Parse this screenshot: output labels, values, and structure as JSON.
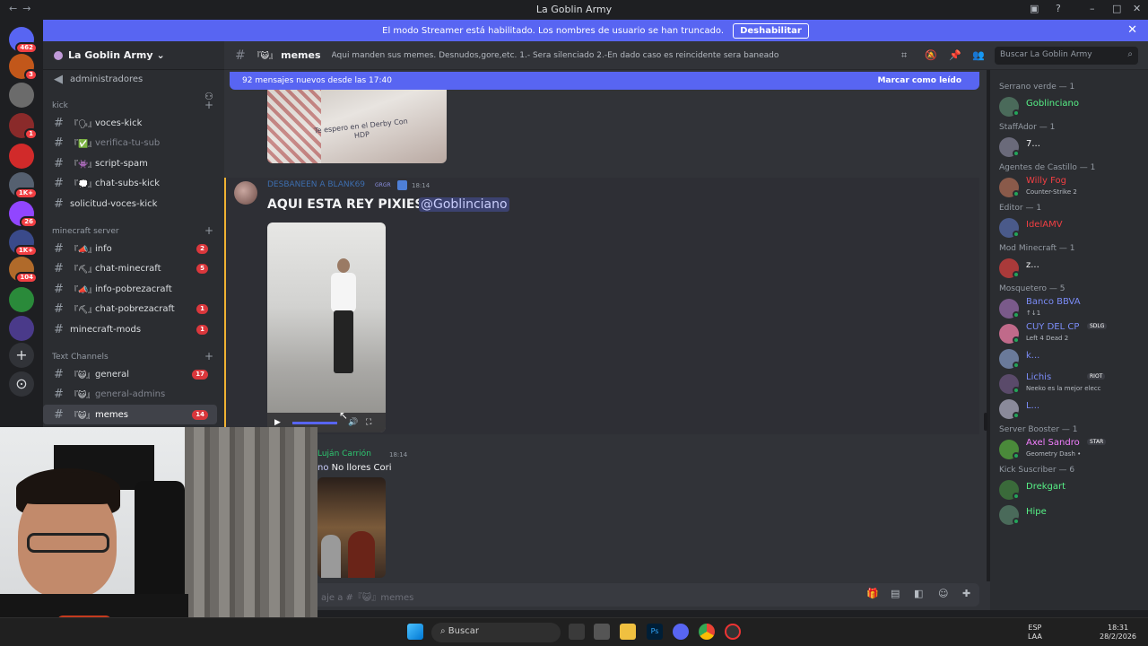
{
  "window": {
    "title": "La Goblin Army"
  },
  "banner": {
    "text": "El modo Streamer está habilitado. Los nombres de usuario se han truncado.",
    "button": "Deshabilitar"
  },
  "servers": [
    {
      "badge": "462",
      "color": "#5865f2"
    },
    {
      "badge": "3",
      "color": "#c2571a"
    },
    {
      "badge": "",
      "color": "#6b6b6b"
    },
    {
      "badge": "1",
      "color": "#8a2a2a"
    },
    {
      "badge": "",
      "color": "#d12a2a"
    },
    {
      "badge": "1K+",
      "color": "#556070"
    },
    {
      "badge": "26",
      "color": "#9146ff"
    },
    {
      "badge": "1K+",
      "color": "#3a4a8a"
    },
    {
      "badge": "104",
      "color": "#b06a2a"
    },
    {
      "badge": "",
      "color": "#2a8a3a"
    },
    {
      "badge": "",
      "color": "#4a3a8a"
    }
  ],
  "guild": {
    "name": "La Goblin Army"
  },
  "channels": {
    "admin": "administradores",
    "categories": [
      "kick",
      "minecraft server",
      "Text Channels"
    ],
    "kick": [
      {
        "emoji": "『🗣』",
        "name": "voces-kick",
        "count": "",
        "muted": false
      },
      {
        "emoji": "『✅』",
        "name": "verifica-tu-sub",
        "count": "",
        "muted": true
      },
      {
        "emoji": "『👾』",
        "name": "script-spam",
        "count": "",
        "muted": false
      },
      {
        "emoji": "『💭』",
        "name": "chat-subs-kick",
        "count": "",
        "muted": false
      },
      {
        "emoji": "",
        "name": "solicitud-voces-kick",
        "count": "",
        "muted": false
      }
    ],
    "minecraft": [
      {
        "emoji": "『📣』",
        "name": "info",
        "count": "2",
        "muted": false
      },
      {
        "emoji": "『⛏』",
        "name": "chat-minecraft",
        "count": "5",
        "muted": false
      },
      {
        "emoji": "『📣』",
        "name": "info-pobrezacraft",
        "count": "",
        "muted": false
      },
      {
        "emoji": "『⛏』",
        "name": "chat-pobrezacraft",
        "count": "1",
        "muted": false
      },
      {
        "emoji": "",
        "name": "minecraft-mods",
        "count": "1",
        "muted": false
      }
    ],
    "text": [
      {
        "emoji": "『😺』",
        "name": "general",
        "count": "17",
        "muted": false
      },
      {
        "emoji": "『😺』",
        "name": "general-admins",
        "count": "",
        "muted": true
      },
      {
        "emoji": "『😺』",
        "name": "memes",
        "count": "14",
        "muted": false,
        "selected": true
      }
    ]
  },
  "header": {
    "channel": "memes",
    "emoji": "『😺』",
    "topic": "Aqui manden sus memes. Desnudos,gore,etc. 1.- Sera silenciado 2.-En dado caso es reincidente sera baneado",
    "search_placeholder": "Buscar La Goblin Army"
  },
  "newbar": {
    "text": "92 mensajes nuevos desde las 17:40",
    "action": "Marcar como leído"
  },
  "image1": {
    "handwriting": "Te espero en el Derby Con HDP"
  },
  "message2": {
    "author": "DESBANEEN A BLANK69",
    "tag": "GRGR",
    "time": "18:14",
    "text": "AQUI ESTA REY PIXIES",
    "mention": "@Goblinciano"
  },
  "message3": {
    "author": "Luján Carrión",
    "time": "18:14",
    "text_prefix": "no",
    "text": "No llores Cori"
  },
  "input": {
    "placeholder": "aje a #『😺』memes"
  },
  "members": [
    {
      "role": "Serrano verde",
      "count": "1",
      "users": [
        {
          "name": "Goblinciano",
          "status": "",
          "color": "#57f287"
        }
      ]
    },
    {
      "role": "StaffAdor",
      "count": "1",
      "users": [
        {
          "name": "7...",
          "status": "",
          "color": "#f2f3f5"
        }
      ]
    },
    {
      "role": "Agentes de Castillo",
      "count": "1",
      "users": [
        {
          "name": "Willy Fog",
          "status": "Counter-Strike 2",
          "color": "#f23f43"
        }
      ]
    },
    {
      "role": "Editor",
      "count": "1",
      "users": [
        {
          "name": "IdelAMV",
          "status": "",
          "color": "#f23f43"
        }
      ]
    },
    {
      "role": "Mod Minecraft",
      "count": "1",
      "users": [
        {
          "name": "z...",
          "status": "",
          "color": "#f2f3f5"
        }
      ]
    },
    {
      "role": "Mosquetero",
      "count": "5",
      "users": [
        {
          "name": "Banco BBVA",
          "status": "↑↓1",
          "color": "#7b8cf7"
        },
        {
          "name": "CUY DEL CP",
          "status": "Left 4 Dead 2",
          "color": "#7b8cf7",
          "tag": "SDLG"
        },
        {
          "name": "k...",
          "status": "",
          "color": "#7b8cf7"
        },
        {
          "name": "Lichis",
          "status": "Neeko es la mejor elecc",
          "color": "#7b8cf7",
          "tag": "RIOT"
        },
        {
          "name": "L...",
          "status": "",
          "color": "#7b8cf7"
        }
      ]
    },
    {
      "role": "Server Booster",
      "count": "1",
      "users": [
        {
          "name": "Axel Sandro",
          "status": "Geometry Dash •",
          "color": "#f47fff",
          "tag": "STAR"
        }
      ]
    },
    {
      "role": "Kick Suscriber",
      "count": "6",
      "users": [
        {
          "name": "Drekgart",
          "status": "",
          "color": "#57f287"
        },
        {
          "name": "Hipe",
          "status": "",
          "color": "#57f287"
        }
      ]
    }
  ],
  "taskbar": {
    "search": "Buscar",
    "lang": "ESP",
    "lang2": "LAA",
    "time": "18:31",
    "date": "28/2/2026"
  }
}
